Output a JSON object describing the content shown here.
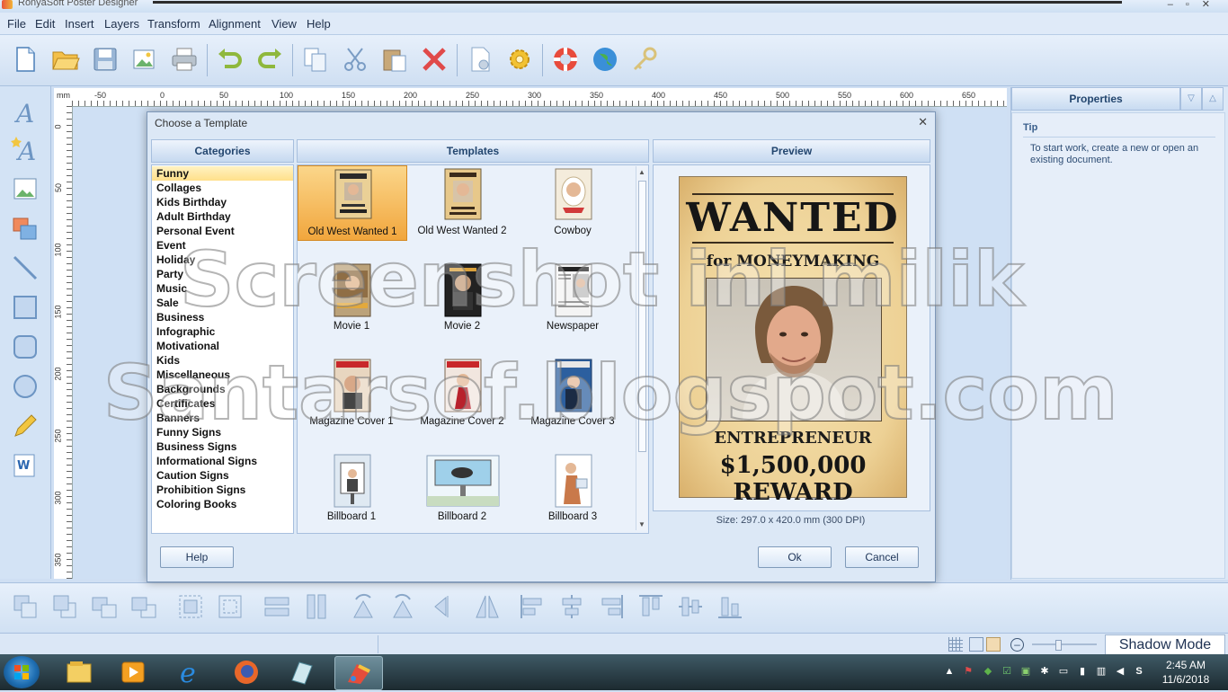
{
  "window": {
    "title": "RonyaSoft Poster Designer"
  },
  "menu": [
    "File",
    "Edit",
    "Insert",
    "Layers",
    "Transform",
    "Alignment",
    "View",
    "Help"
  ],
  "ruler": {
    "unit": "mm",
    "h_labels": [
      "-50",
      "0",
      "50",
      "100",
      "150",
      "200",
      "250",
      "300",
      "350",
      "400",
      "450",
      "500",
      "550",
      "600",
      "650"
    ],
    "v_labels": [
      "0",
      "50",
      "100",
      "150",
      "200",
      "250",
      "300",
      "350"
    ]
  },
  "properties": {
    "title": "Properties",
    "tip_heading": "Tip",
    "tip_text": "To start work, create a new or open an existing document."
  },
  "dialog": {
    "title": "Choose a Template",
    "categories_header": "Categories",
    "templates_header": "Templates",
    "preview_header": "Preview",
    "categories": [
      "Funny",
      "Collages",
      "Kids Birthday",
      "Adult Birthday",
      "Personal Event",
      "Event",
      "Holiday",
      "Party",
      "Music",
      "Sale",
      "Business",
      "Infographic",
      "Motivational",
      "Kids",
      "Miscellaneous",
      "Backgrounds",
      "Certificates",
      "Banners",
      "Funny Signs",
      "Business Signs",
      "Informational Signs",
      "Caution Signs",
      "Prohibition Signs",
      "Coloring Books"
    ],
    "selected_category": "Funny",
    "templates": [
      "Old West Wanted 1",
      "Old West Wanted 2",
      "Cowboy",
      "Movie 1",
      "Movie 2",
      "Newspaper",
      "Magazine Cover 1",
      "Magazine Cover 2",
      "Magazine Cover 3",
      "Billboard 1",
      "Billboard 2",
      "Billboard 3"
    ],
    "selected_template": "Old West Wanted 1",
    "preview": {
      "line1": "WANTED",
      "line2": "for MONEYMAKING",
      "line3": "ENTREPRENEUR",
      "line4": "$1,500,000 REWARD"
    },
    "size_info": "Size: 297.0 x 420.0 mm (300 DPI)",
    "help_label": "Help",
    "ok_label": "Ok",
    "cancel_label": "Cancel"
  },
  "statusbar": {
    "shadow_mode": "Shadow Mode"
  },
  "taskbar": {
    "time": "2:45 AM",
    "date": "11/6/2018"
  },
  "watermark": {
    "line1": "Screenshot ini milik",
    "line2": "Santarsof.blogspot.com"
  }
}
